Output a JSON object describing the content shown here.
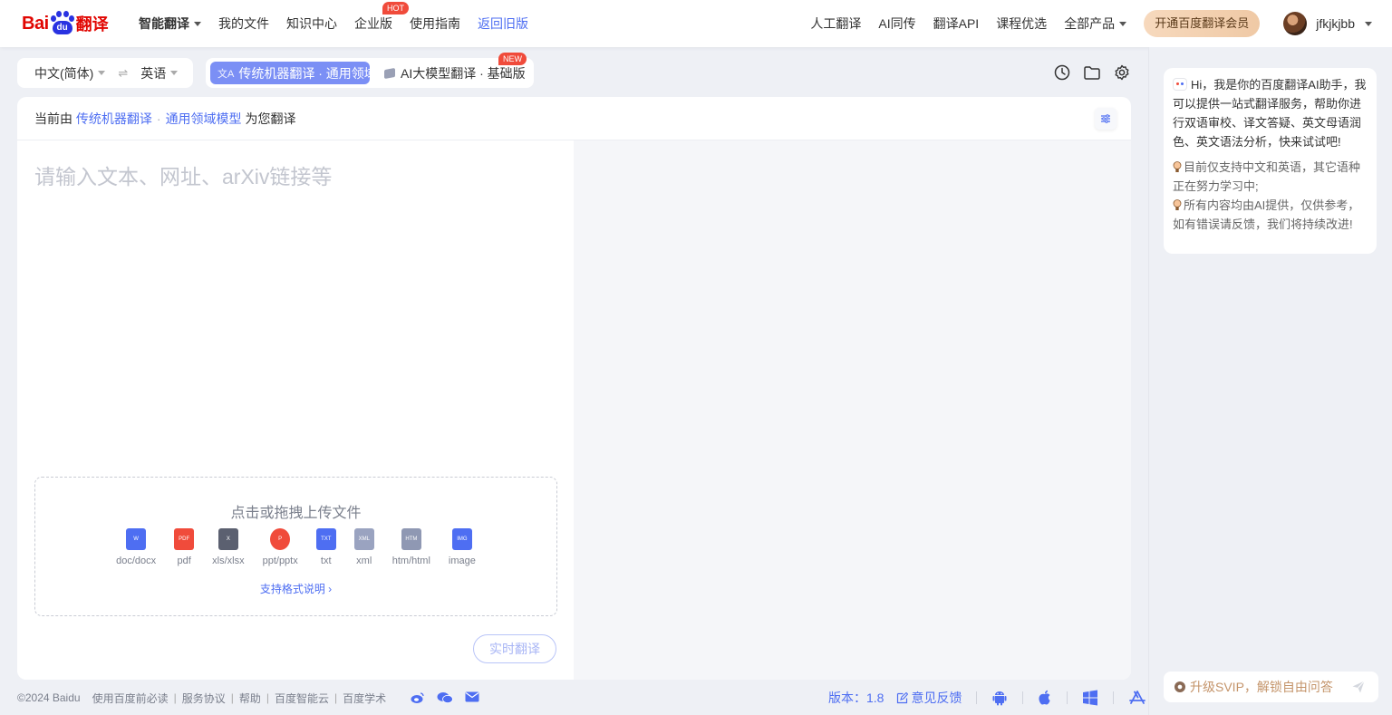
{
  "brand": {
    "logo_left": "Bai",
    "logo_paw": "du",
    "logo_right": "翻译"
  },
  "nav": {
    "items_left": [
      {
        "label": "智能翻译",
        "dropdown": true,
        "bold": true
      },
      {
        "label": "我的文件"
      },
      {
        "label": "知识中心"
      },
      {
        "label": "企业版",
        "badge": "HOT"
      },
      {
        "label": "使用指南"
      },
      {
        "label": "返回旧版",
        "active": true
      }
    ],
    "items_right": [
      {
        "label": "人工翻译"
      },
      {
        "label": "AI同传"
      },
      {
        "label": "翻译API"
      },
      {
        "label": "课程优选"
      },
      {
        "label": "全部产品",
        "dropdown": true
      }
    ],
    "vip_button": "开通百度翻译会员",
    "username": "jfkjkjbb"
  },
  "lang": {
    "source": "中文(简体)",
    "target": "英语",
    "swap_icon": "swap-icon"
  },
  "modes": {
    "active": "传统机器翻译 · 通用领域",
    "other": "AI大模型翻译 · 基础版",
    "new_badge": "NEW"
  },
  "panel": {
    "head_prefix": "当前由",
    "head_engine": "传统机器翻译",
    "head_dot": "·",
    "head_model": "通用领域模型",
    "head_suffix": "为您翻译",
    "placeholder": "请输入文本、网址、arXiv链接等",
    "upload_title": "点击或拖拽上传文件",
    "file_types": [
      {
        "label": "doc/docx",
        "color": "#4e6ef2",
        "glyph": "W"
      },
      {
        "label": "pdf",
        "color": "#f04b3b",
        "glyph": "PDF"
      },
      {
        "label": "xls/xlsx",
        "color": "#5b6070",
        "glyph": "X"
      },
      {
        "label": "ppt/pptx",
        "color": "#f04b3b",
        "glyph": "P"
      },
      {
        "label": "txt",
        "color": "#4e6ef2",
        "glyph": "TXT"
      },
      {
        "label": "xml",
        "color": "#9aa3c0",
        "glyph": "XML"
      },
      {
        "label": "htm/html",
        "color": "#8f98b3",
        "glyph": "HTM"
      },
      {
        "label": "image",
        "color": "#4e6ef2",
        "glyph": "IMG"
      }
    ],
    "format_link": "支持格式说明",
    "realtime_button": "实时翻译"
  },
  "assistant": {
    "greeting": "Hi，我是你的百度翻译AI助手，我可以提供一站式翻译服务，帮助你进行双语审校、译文答疑、英文母语润色、英文语法分析，快来试试吧!",
    "note1": "目前仅支持中文和英语，其它语种正在努力学习中;",
    "note2": "所有内容均由AI提供，仅供参考，如有错误请反馈，我们将持续改进!",
    "input_placeholder": "升级SVIP，解锁自由问答"
  },
  "footer": {
    "copyright": "©2024 Baidu",
    "links": [
      "使用百度前必读",
      "服务协议",
      "帮助",
      "百度智能云",
      "百度学术"
    ],
    "version_label": "版本：",
    "version": "1.8",
    "feedback": "意见反馈"
  },
  "colors": {
    "accent": "#4e6ef2",
    "brand_red": "#e10602",
    "brand_blue": "#2932e1",
    "badge_red": "#f04b3b"
  }
}
